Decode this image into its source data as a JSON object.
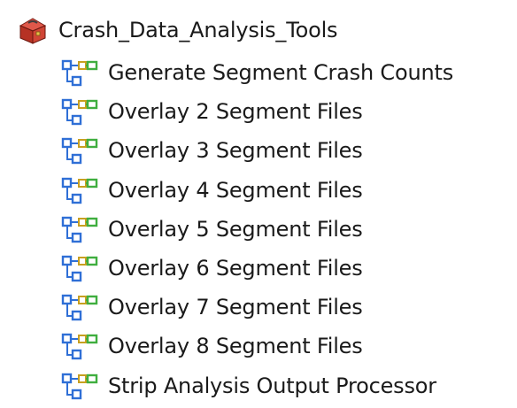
{
  "toolbox": {
    "label": "Crash_Data_Analysis_Tools",
    "icon": "toolbox-icon"
  },
  "tools": [
    {
      "label": "Generate Segment Crash Counts",
      "icon": "model-tool-icon"
    },
    {
      "label": "Overlay 2 Segment Files",
      "icon": "model-tool-icon"
    },
    {
      "label": "Overlay 3 Segment Files",
      "icon": "model-tool-icon"
    },
    {
      "label": "Overlay 4 Segment Files",
      "icon": "model-tool-icon"
    },
    {
      "label": "Overlay 5 Segment Files",
      "icon": "model-tool-icon"
    },
    {
      "label": "Overlay 6 Segment Files",
      "icon": "model-tool-icon"
    },
    {
      "label": "Overlay 7 Segment Files",
      "icon": "model-tool-icon"
    },
    {
      "label": "Overlay 8 Segment Files",
      "icon": "model-tool-icon"
    },
    {
      "label": "Strip Analysis Output Processor",
      "icon": "model-tool-icon"
    }
  ],
  "colors": {
    "toolbox_red": "#c0392b",
    "model_blue": "#2f6fd6",
    "model_green": "#3fae3f"
  }
}
